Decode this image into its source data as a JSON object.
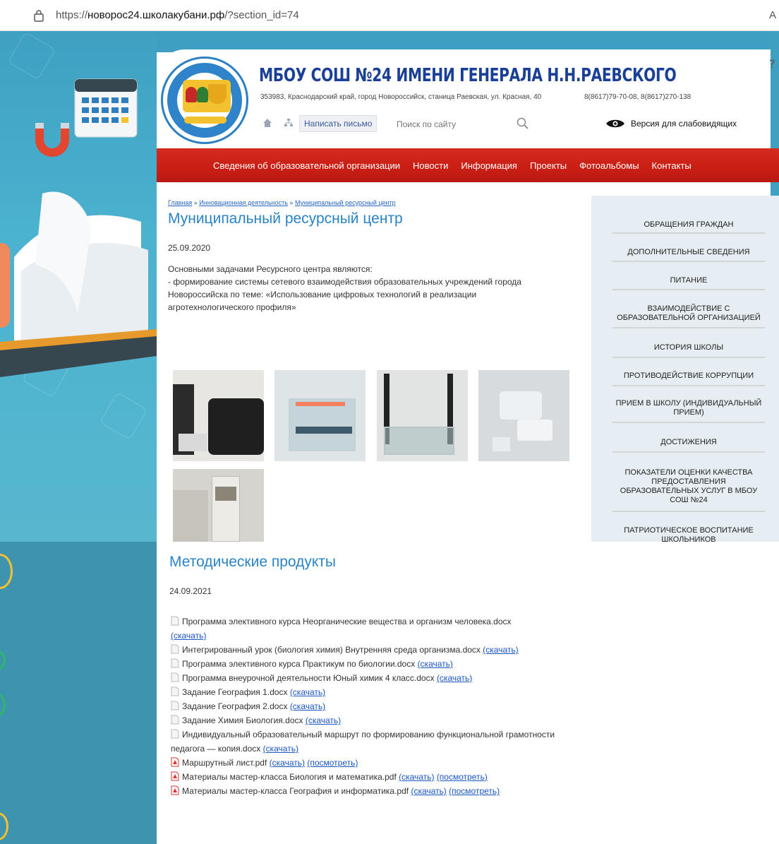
{
  "browser": {
    "url_prefix": "https://",
    "url_host": "новорос24.школакубани.рф",
    "url_path": "/?section_id=74",
    "right_text": "A"
  },
  "header": {
    "title": "МБОУ СОШ №24 ИМЕНИ ГЕНЕРАЛА Н.Н.РАЕВСКОГО",
    "address": "353983, Краснодарский край, город Новороссийск, станица Раевская, ул. Красная, 40",
    "phones": "8(8617)79-70-08, 8(8617)270-138",
    "write_button": "Написать письмо",
    "search_placeholder": "Поиск по сайту",
    "vision_link": "Версия для слабовидящих"
  },
  "nav": {
    "items": [
      "Сведения об образовательной организации",
      "Новости",
      "Информация",
      "Проекты",
      "Фотоальбомы",
      "Контакты"
    ]
  },
  "breadcrumb": {
    "items": [
      "Главная",
      "Инновационная деятельность",
      "Муниципальный ресурсный центр"
    ],
    "separator": " » "
  },
  "page": {
    "title": "Муниципальный ресурсный центр",
    "date": "25.09.2020",
    "text_line1": "Основными задачами Ресурсного центра являются:",
    "text_line2": "- формирование системы сетевого взаимодействия образовательных учреждений города Новороссийска по теме: «Использование цифровых технологий в реализации агротехнологического профиля»"
  },
  "sidebar": {
    "items": [
      "ОБРАЩЕНИЯ ГРАЖДАН",
      "ДОПОЛНИТЕЛЬНЫЕ СВЕДЕНИЯ",
      "ПИТАНИЕ",
      "ВЗАИМОДЕЙСТВИЕ С ОБРАЗОВАТЕЛЬНОЙ ОРГАНИЗАЦИЕЙ",
      "ИСТОРИЯ ШКОЛЫ",
      "ПРОТИВОДЕЙСТВИЕ КОРРУПЦИИ",
      "ПРИЕМ В ШКОЛУ (ИНДИВИДУАЛЬНЫЙ ПРИЕМ)",
      "ДОСТИЖЕНИЯ",
      "ПОКАЗАТЕЛИ ОЦЕНКИ КАЧЕСТВА ПРЕДОСТАВЛЕНИЯ ОБРАЗОВАТЕЛЬНЫХ УСЛУГ В МБОУ СОШ №24",
      "ПАТРИОТИЧЕСКОЕ ВОСПИТАНИЕ ШКОЛЬНИКОВ"
    ]
  },
  "section2": {
    "title": "Методические продукты",
    "date": "24.09.2021",
    "download_label": "(скачать)",
    "view_label": "(посмотреть)",
    "files": [
      {
        "name": "Программа элективного курса Неорганические вещества и организм человека.docx",
        "type": "doc"
      },
      {
        "name": "Интегрированный урок (биология химия) Внутренняя среда организма.docx",
        "type": "doc"
      },
      {
        "name": "Программа элективного курса Практикум по биологии.docx",
        "type": "doc"
      },
      {
        "name": "Программа внеурочной деятельности Юный химик 4 класс.docx",
        "type": "doc"
      },
      {
        "name": "Задание География 1.docx",
        "type": "doc"
      },
      {
        "name": "Задание География 2.docx",
        "type": "doc"
      },
      {
        "name": "Задание Химия Биология.docx",
        "type": "doc"
      },
      {
        "name": "Индивидуальный образовательный маршрут по формированию функциональной грамотности педагога — копия.docx",
        "type": "doc"
      },
      {
        "name": "Маршрутный лист.pdf",
        "type": "pdf"
      },
      {
        "name": "Материалы мастер-класса Биология и математика.pdf",
        "type": "pdf"
      },
      {
        "name": "Материалы мастер-класса География и информатика.pdf",
        "type": "pdf"
      }
    ]
  },
  "colors": {
    "nav_red": "#c81e14",
    "title_blue": "#2a83c7",
    "link_blue": "#1a56c4",
    "school_title": "#1a3f96",
    "sidebar_bg": "#e6eef3"
  }
}
